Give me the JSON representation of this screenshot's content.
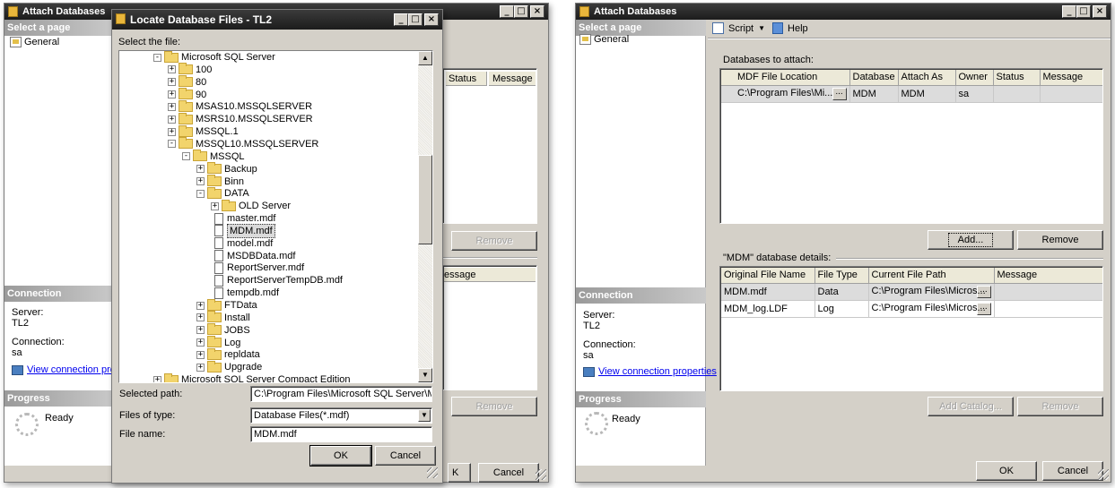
{
  "left_window": {
    "title": "Attach Databases",
    "select_a_page": "Select a page",
    "nav_general": "General",
    "connection_header": "Connection",
    "server_label": "Server:",
    "server_value": "TL2",
    "connection_label": "Connection:",
    "connection_value": "sa",
    "view_connection_link": "View connection prop",
    "progress_header": "Progress",
    "progress_status": "Ready",
    "grid_status_header": "Status",
    "grid_message_header": "Message",
    "remove_button": "Remove",
    "details_message_header": "essage",
    "remove2_button": "Remove",
    "ok_button_partial": "K",
    "cancel_button": "Cancel"
  },
  "locate_dialog": {
    "title": "Locate Database Files - TL2",
    "select_file_label": "Select the file:",
    "tree": [
      {
        "label": "Microsoft SQL Server",
        "level": 0,
        "kind": "folder",
        "expander": "-"
      },
      {
        "label": "100",
        "level": 1,
        "kind": "folder",
        "expander": "+"
      },
      {
        "label": "80",
        "level": 1,
        "kind": "folder",
        "expander": "+"
      },
      {
        "label": "90",
        "level": 1,
        "kind": "folder",
        "expander": "+"
      },
      {
        "label": "MSAS10.MSSQLSERVER",
        "level": 1,
        "kind": "folder",
        "expander": "+"
      },
      {
        "label": "MSRS10.MSSQLSERVER",
        "level": 1,
        "kind": "folder",
        "expander": "+"
      },
      {
        "label": "MSSQL.1",
        "level": 1,
        "kind": "folder",
        "expander": "+"
      },
      {
        "label": "MSSQL10.MSSQLSERVER",
        "level": 1,
        "kind": "folder",
        "expander": "-"
      },
      {
        "label": "MSSQL",
        "level": 2,
        "kind": "folder",
        "expander": "-"
      },
      {
        "label": "Backup",
        "level": 3,
        "kind": "folder",
        "expander": "+"
      },
      {
        "label": "Binn",
        "level": 3,
        "kind": "folder",
        "expander": "+"
      },
      {
        "label": "DATA",
        "level": 3,
        "kind": "folder",
        "expander": "-"
      },
      {
        "label": "OLD Server",
        "level": 4,
        "kind": "folder",
        "expander": "+"
      },
      {
        "label": "master.mdf",
        "level": 4,
        "kind": "file",
        "expander": ""
      },
      {
        "label": "MDM.mdf",
        "level": 4,
        "kind": "file",
        "expander": "",
        "selected": true
      },
      {
        "label": "model.mdf",
        "level": 4,
        "kind": "file",
        "expander": ""
      },
      {
        "label": "MSDBData.mdf",
        "level": 4,
        "kind": "file",
        "expander": ""
      },
      {
        "label": "ReportServer.mdf",
        "level": 4,
        "kind": "file",
        "expander": ""
      },
      {
        "label": "ReportServerTempDB.mdf",
        "level": 4,
        "kind": "file",
        "expander": ""
      },
      {
        "label": "tempdb.mdf",
        "level": 4,
        "kind": "file",
        "expander": ""
      },
      {
        "label": "FTData",
        "level": 3,
        "kind": "folder",
        "expander": "+"
      },
      {
        "label": "Install",
        "level": 3,
        "kind": "folder",
        "expander": "+"
      },
      {
        "label": "JOBS",
        "level": 3,
        "kind": "folder",
        "expander": "+"
      },
      {
        "label": "Log",
        "level": 3,
        "kind": "folder",
        "expander": "+"
      },
      {
        "label": "repldata",
        "level": 3,
        "kind": "folder",
        "expander": "+"
      },
      {
        "label": "Upgrade",
        "level": 3,
        "kind": "folder",
        "expander": "+"
      },
      {
        "label": "Microsoft SQL Server Compact Edition",
        "level": 0,
        "kind": "folder",
        "expander": "+"
      }
    ],
    "selected_path_label": "Selected path:",
    "selected_path_value": "C:\\Program Files\\Microsoft SQL Server\\MSSQL",
    "files_of_type_label": "Files of type:",
    "files_of_type_value": "Database Files(*.mdf)",
    "file_name_label": "File name:",
    "file_name_value": "MDM.mdf",
    "ok_button": "OK",
    "cancel_button": "Cancel"
  },
  "right_window": {
    "title": "Attach Databases",
    "select_a_page": "Select a page",
    "nav_general": "General",
    "script_button": "Script",
    "help_button": "Help",
    "databases_to_attach_label": "Databases to attach:",
    "attach_columns": [
      "MDF File Location",
      "Database ...",
      "Attach As",
      "Owner",
      "Status",
      "Message"
    ],
    "attach_rows": [
      {
        "location": "C:\\Program Files\\Mi...",
        "database": "MDM",
        "attach_as": "MDM",
        "owner": "sa",
        "status": "",
        "message": ""
      }
    ],
    "add_button": "Add...",
    "remove_button": "Remove",
    "details_label": "\"MDM\" database details:",
    "detail_columns": [
      "Original File Name",
      "File Type",
      "Current File Path",
      "Message"
    ],
    "detail_rows": [
      {
        "name": "MDM.mdf",
        "type": "Data",
        "path": "C:\\Program Files\\Micros...",
        "message": ""
      },
      {
        "name": "MDM_log.LDF",
        "type": "Log",
        "path": "C:\\Program Files\\Micros...",
        "message": ""
      }
    ],
    "add_catalog_button": "Add Catalog...",
    "remove2_button": "Remove",
    "connection_header": "Connection",
    "server_label": "Server:",
    "server_value": "TL2",
    "connection_label": "Connection:",
    "connection_value": "sa",
    "view_connection_link": "View connection properties",
    "progress_header": "Progress",
    "progress_status": "Ready",
    "ok_button": "OK",
    "cancel_button": "Cancel"
  }
}
